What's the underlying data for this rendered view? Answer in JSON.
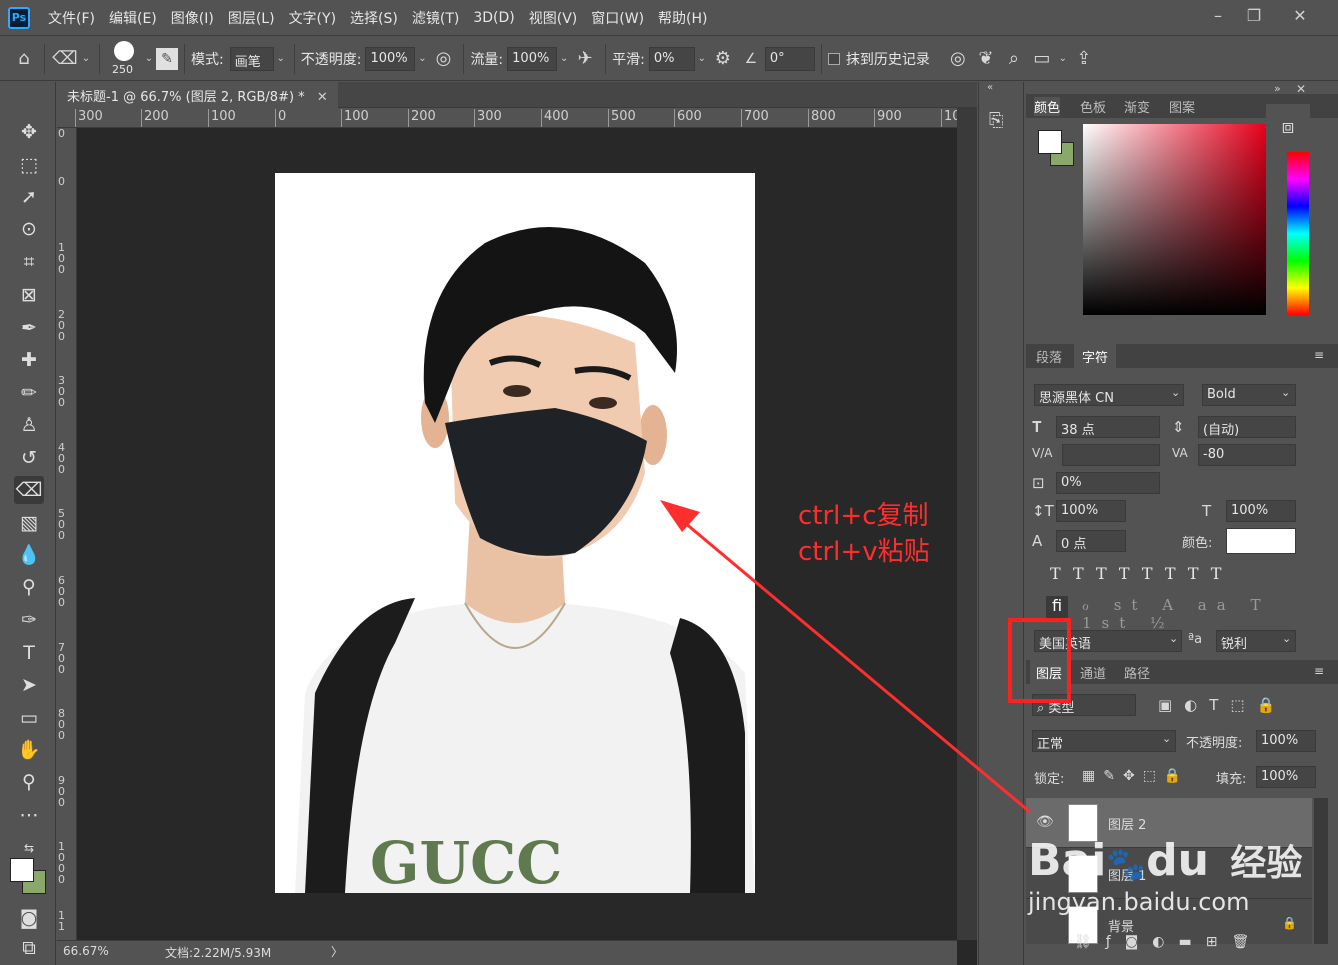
{
  "app": {
    "logo": "Ps"
  },
  "menu": [
    "文件(F)",
    "编辑(E)",
    "图像(I)",
    "图层(L)",
    "文字(Y)",
    "选择(S)",
    "滤镜(T)",
    "3D(D)",
    "视图(V)",
    "窗口(W)",
    "帮助(H)"
  ],
  "window_controls": {
    "minimize": "–",
    "maximize": "❐",
    "close": "✕"
  },
  "options_bar": {
    "brush_size": "250",
    "mode_label": "模式:",
    "mode_value": "画笔",
    "opacity_label": "不透明度:",
    "opacity_value": "100%",
    "flow_label": "流量:",
    "flow_value": "100%",
    "smooth_label": "平滑:",
    "smooth_value": "0%",
    "angle_value": "0°",
    "erase_history_label": "抹到历史记录"
  },
  "document": {
    "tab_title": "未标题-1 @ 66.7% (图层 2, RGB/8#) *",
    "zoom": "66.67%",
    "doc_size": "文档:2.22M/5.93M",
    "ruler_h": [
      "300",
      "200",
      "100",
      "0",
      "100",
      "200",
      "300",
      "400",
      "500",
      "600",
      "700",
      "800",
      "900",
      "10"
    ],
    "ruler_v": [
      "0",
      "0",
      "100",
      "200",
      "300",
      "400",
      "500",
      "600",
      "700",
      "800",
      "900",
      "1000",
      "11"
    ]
  },
  "panels": {
    "color_tabs": [
      "颜色",
      "色板",
      "渐变",
      "图案"
    ],
    "char_tabs": [
      "段落",
      "字符"
    ],
    "font_family": "思源黑体 CN",
    "font_style": "Bold",
    "font_size": "38 点",
    "leading": "(自动)",
    "kerning": "",
    "tracking": "-80",
    "scale_pct": "0%",
    "vscale": "100%",
    "hscale": "100%",
    "baseline": "0 点",
    "color_label": "颜色:",
    "language": "美国英语",
    "antialias": "锐利",
    "layer_tabs": [
      "图层",
      "通道",
      "路径"
    ],
    "filter_kind": "类型",
    "blend_mode": "正常",
    "layer_opacity_label": "不透明度:",
    "layer_opacity": "100%",
    "lock_label": "锁定:",
    "fill_label": "填充:",
    "fill_value": "100%",
    "layers": [
      "图层 2",
      "图层 1",
      "背景"
    ]
  },
  "colors": {
    "annotation": "#ff2e2e",
    "highlight": "#ff2020",
    "foreground": "#ffffff",
    "background": "#8aa86a"
  },
  "annotation": {
    "line1": "ctrl+c复制",
    "line2": "ctrl+v粘贴"
  },
  "watermark": {
    "brand": "Bai",
    "paw": "du",
    "cn": "经验",
    "url": "jingyan.baidu.com"
  }
}
